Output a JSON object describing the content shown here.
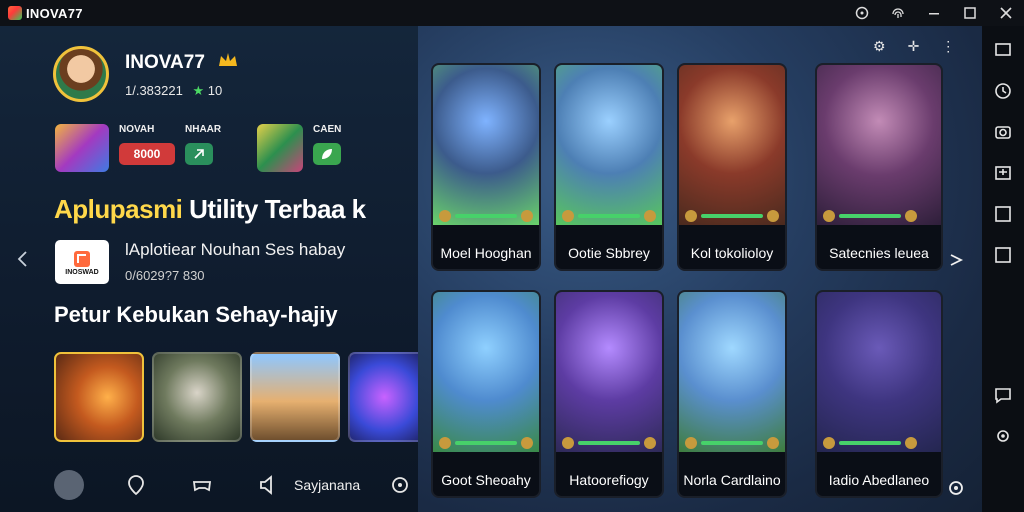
{
  "window": {
    "brand": "INOVA77",
    "controls": [
      "target-icon",
      "fingerprint-icon",
      "minimize-icon",
      "maximize-icon",
      "close-icon"
    ]
  },
  "profile": {
    "username": "INOVA77",
    "stats": "1/.383221",
    "level": "10"
  },
  "chips": [
    {
      "label": "NOVAH",
      "badge": "8000",
      "badge_color": "#d13a3a"
    },
    {
      "label": "NHAAR",
      "badge": "",
      "badge_color": "#2a8f5c"
    },
    {
      "label": "CAEN",
      "badge": "",
      "badge_color": "#3aa64f"
    }
  ],
  "headline": {
    "yellow": "Aplupasmi",
    "white": "Utility Terbaa k"
  },
  "app": {
    "logo_text": "INOSWAD",
    "title": "lAplotiear Nouhan Ses habay",
    "subtitle": "0/6029?7 830"
  },
  "section2": "Petur Kebukan Sehay-hajiy",
  "bottombar": {
    "label": "Sayjanana"
  },
  "cards": [
    {
      "label": "Moel Hooghan",
      "palette": [
        "#7fb3ff",
        "#3c5b8c",
        "#6ad36a"
      ]
    },
    {
      "label": "Ootie Sbbrey",
      "palette": [
        "#9bd0ff",
        "#4d7fb4",
        "#58c65d"
      ]
    },
    {
      "label": "Kol tokolioloy",
      "palette": [
        "#e8a16b",
        "#8a3a2a",
        "#4a2a1e"
      ]
    },
    {
      "label": "Satecnies leuea",
      "palette": [
        "#c28bb6",
        "#6a3c6d",
        "#2e1f3a"
      ]
    },
    {
      "label": "Goot Sheoahy",
      "palette": [
        "#8fd0ff",
        "#4f8bcf",
        "#3a8a47"
      ]
    },
    {
      "label": "Hatoorefiogy",
      "palette": [
        "#b48bff",
        "#5d3ca3",
        "#2e2a58"
      ]
    },
    {
      "label": "Norla Cardlaino",
      "palette": [
        "#9fd8ff",
        "#5a8fcf",
        "#3e7d3d"
      ]
    },
    {
      "label": "Iadio Abedlaneo",
      "palette": [
        "#6a5ab8",
        "#3e3580",
        "#242650"
      ]
    }
  ],
  "rail_icons": [
    "screen-record-icon",
    "clock-icon",
    "camera-icon",
    "keyboard-icon",
    "window-icon",
    "window-icon-2",
    "message-icon",
    "settings-icon"
  ]
}
